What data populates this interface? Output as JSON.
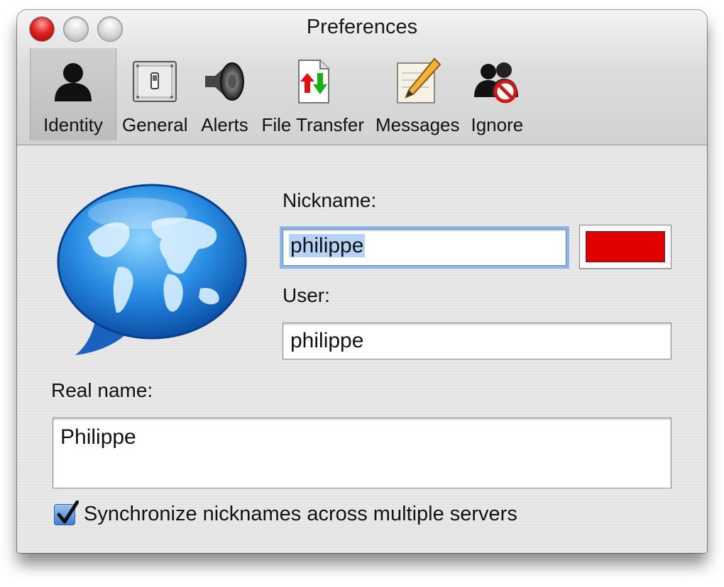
{
  "window": {
    "title": "Preferences"
  },
  "toolbar": {
    "items": [
      {
        "label": "Identity",
        "icon": "person-silhouette-icon"
      },
      {
        "label": "General",
        "icon": "switch-panel-icon"
      },
      {
        "label": "Alerts",
        "icon": "speaker-icon"
      },
      {
        "label": "File Transfer",
        "icon": "transfer-arrows-icon"
      },
      {
        "label": "Messages",
        "icon": "pencil-note-icon"
      },
      {
        "label": "Ignore",
        "icon": "ignore-users-icon"
      }
    ],
    "active": "Identity"
  },
  "identity": {
    "avatar_icon": "globe-speech-bubble-icon",
    "nickname_label": "Nickname:",
    "nickname_value": "philippe",
    "nickname_color": "#e00000",
    "user_label": "User:",
    "user_value": "philippe",
    "realname_label": "Real name:",
    "realname_value": "Philippe",
    "sync_label": "Synchronize nicknames across multiple servers",
    "sync_checked": true
  },
  "colors": {
    "accent": "#3d7fd6",
    "selection": "#b6d2f4"
  }
}
